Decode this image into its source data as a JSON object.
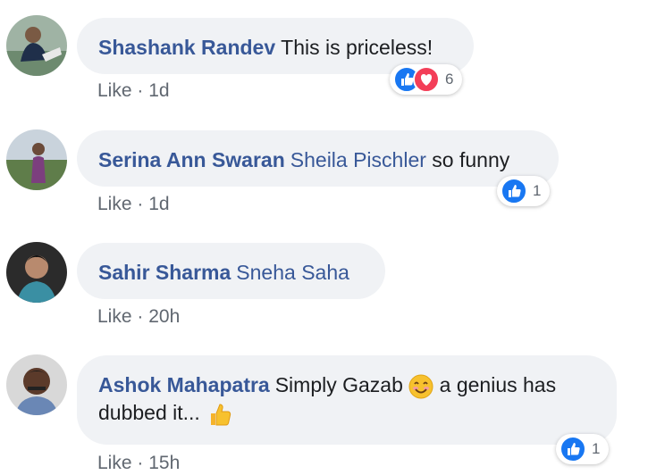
{
  "comments": [
    {
      "author": "Shashank Randev",
      "text": "This is priceless!",
      "like_label": "Like",
      "separator": "·",
      "time": "1d",
      "reaction_count": "6",
      "reactions": [
        "like-icon",
        "love-icon"
      ]
    },
    {
      "author": "Serina Ann Swaran",
      "mention": "Sheila Pischler",
      "text": "so funny",
      "like_label": "Like",
      "separator": "·",
      "time": "1d",
      "reaction_count": "1",
      "reactions": [
        "like-icon"
      ]
    },
    {
      "author": "Sahir Sharma",
      "mention": "Sneha Saha",
      "like_label": "Like",
      "separator": "·",
      "time": "20h"
    },
    {
      "author": "Ashok Mahapatra",
      "text_part1": "Simply Gazab",
      "text_part2": "a genius has",
      "text_line2": "dubbed it...",
      "emojis": [
        "smiling-face-icon",
        "thumbs-up-emoji-icon"
      ],
      "like_label": "Like",
      "separator": "·",
      "time": "15h",
      "reaction_count": "1",
      "reactions": [
        "like-icon"
      ]
    }
  ],
  "colors": {
    "bubble": "#f0f2f5",
    "link": "#385898",
    "meta": "#606770",
    "like_blue": "#1877f2",
    "love_red": "#f33e58"
  }
}
